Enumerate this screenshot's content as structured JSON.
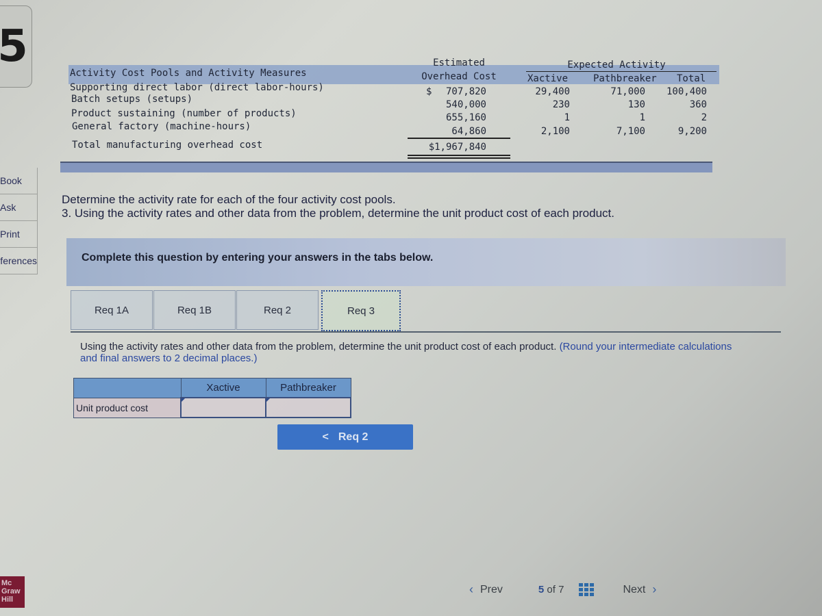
{
  "sidebar": {
    "question_number": "5",
    "links": [
      "Book",
      "Ask",
      "Print",
      "References"
    ],
    "logo": [
      "Mc",
      "Graw",
      "Hill"
    ]
  },
  "data_table": {
    "title": "Activity Cost Pools and Activity Measures",
    "headers": {
      "estimated_top": "Estimated",
      "estimated_bottom": "Overhead Cost",
      "expected_activity": "Expected Activity",
      "xactive": "Xactive",
      "pathbreaker": "Pathbreaker",
      "total": "Total"
    },
    "rows": [
      {
        "label": "Supporting direct labor (direct labor-hours)",
        "currency": "$",
        "cost": "707,820",
        "xactive": "29,400",
        "pathbreaker": "71,000",
        "total": "100,400"
      },
      {
        "label": "Batch setups (setups)",
        "currency": "",
        "cost": "540,000",
        "xactive": "230",
        "pathbreaker": "130",
        "total": "360"
      },
      {
        "label": "Product sustaining (number of products)",
        "currency": "",
        "cost": "655,160",
        "xactive": "1",
        "pathbreaker": "1",
        "total": "2"
      },
      {
        "label": "General factory (machine-hours)",
        "currency": "",
        "cost": "64,860",
        "xactive": "2,100",
        "pathbreaker": "7,100",
        "total": "9,200"
      }
    ],
    "total_label": "Total manufacturing overhead cost",
    "total_value": "$1,967,840"
  },
  "instructions": {
    "line1": "Determine the activity rate for each of the four activity cost pools.",
    "line2": "3. Using the activity rates and other data from the problem, determine the unit product cost of each product."
  },
  "panel": {
    "complete_text": "Complete this question by entering your answers in the tabs below."
  },
  "tabs": [
    {
      "label": "Req 1A",
      "active": false
    },
    {
      "label": "Req 1B",
      "active": false
    },
    {
      "label": "Req 2",
      "active": false
    },
    {
      "label": "Req 3",
      "active": true
    }
  ],
  "req3": {
    "text": "Using the activity rates and other data from the problem, determine the unit product cost of each product.",
    "hint": "(Round your intermediate calculations and final answers to 2 decimal places.)",
    "answer_table": {
      "columns": [
        "Xactive",
        "Pathbreaker"
      ],
      "row_label": "Unit product cost",
      "values": [
        "",
        ""
      ]
    },
    "prev_button": "Req 2"
  },
  "bottom_nav": {
    "prev": "Prev",
    "current_page": "5",
    "of": "of",
    "total_pages": "7",
    "next": "Next"
  }
}
